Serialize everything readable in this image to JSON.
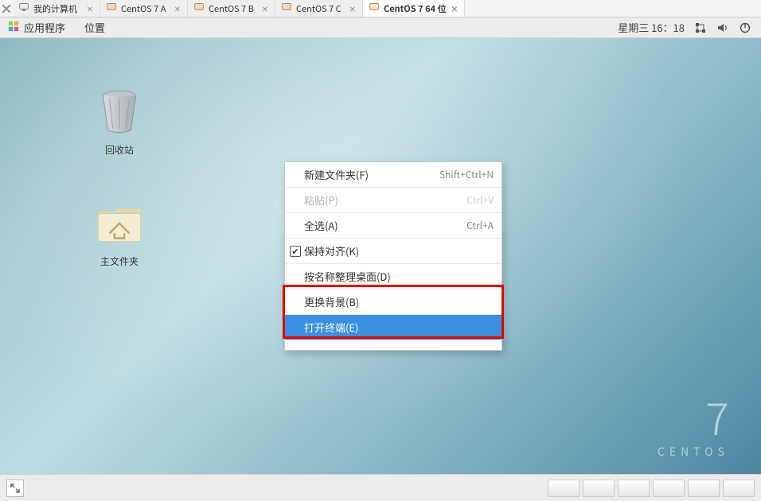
{
  "tabs": [
    {
      "label": "我的计算机",
      "type": "host"
    },
    {
      "label": "CentOS 7 A",
      "type": "vm"
    },
    {
      "label": "CentOS 7 B",
      "type": "vm"
    },
    {
      "label": "CentOS 7 C",
      "type": "vm"
    },
    {
      "label": "CentOS 7 64 位",
      "type": "vm",
      "active": true
    }
  ],
  "menubar": {
    "applications": "应用程序",
    "places": "位置",
    "clock": "星期三 16：18"
  },
  "desktop_icons": {
    "trash": "回收站",
    "home": "主文件夹"
  },
  "context_menu": {
    "items": [
      {
        "label": "新建文件夹(F)",
        "shortcut": "Shift+Ctrl+N",
        "disabled": false,
        "checked": false
      },
      {
        "label": "粘贴(P)",
        "shortcut": "Ctrl+V",
        "disabled": true,
        "checked": false
      },
      {
        "label": "全选(A)",
        "shortcut": "Ctrl+A",
        "disabled": false,
        "checked": false
      },
      {
        "label": "保持对齐(K)",
        "shortcut": "",
        "disabled": false,
        "checked": true
      },
      {
        "label": "按名称整理桌面(D)",
        "shortcut": "",
        "disabled": false,
        "checked": false
      },
      {
        "label": "更换背景(B)",
        "shortcut": "",
        "disabled": false,
        "checked": false
      },
      {
        "label": "打开终端(E)",
        "shortcut": "",
        "disabled": false,
        "checked": false,
        "highlight": true
      }
    ]
  },
  "branding": {
    "number": "7",
    "name": "CENTOS"
  }
}
